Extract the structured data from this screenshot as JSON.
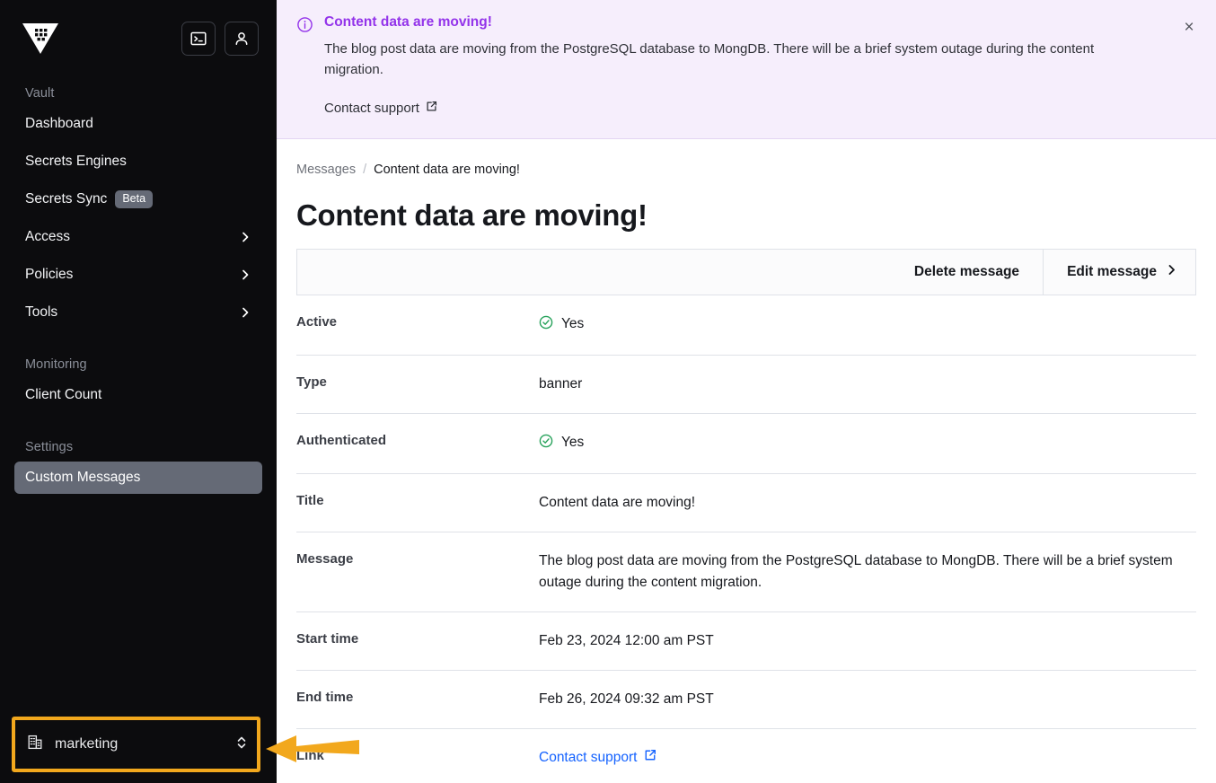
{
  "sidebar": {
    "logo_icon": "vault-logo",
    "actions": [
      {
        "name": "console-toggle-button",
        "icon": "console-icon"
      },
      {
        "name": "user-menu-button",
        "icon": "user-icon"
      }
    ],
    "sections": [
      {
        "label": "Vault",
        "items": [
          {
            "label": "Dashboard",
            "has_chevron": false,
            "active": false
          },
          {
            "label": "Secrets Engines",
            "has_chevron": false,
            "active": false
          },
          {
            "label": "Secrets Sync",
            "badge": "Beta",
            "has_chevron": false,
            "active": false
          },
          {
            "label": "Access",
            "has_chevron": true,
            "active": false
          },
          {
            "label": "Policies",
            "has_chevron": true,
            "active": false
          },
          {
            "label": "Tools",
            "has_chevron": true,
            "active": false
          }
        ]
      },
      {
        "label": "Monitoring",
        "items": [
          {
            "label": "Client Count",
            "has_chevron": false,
            "active": false
          }
        ]
      },
      {
        "label": "Settings",
        "items": [
          {
            "label": "Custom Messages",
            "has_chevron": false,
            "active": true
          }
        ]
      }
    ],
    "namespace_picker": {
      "icon": "building-icon",
      "label": "marketing",
      "selector_icon": "chevron-up-down-icon"
    }
  },
  "annotation": {
    "highlight_color": "#F2A81D",
    "arrow_color": "#F2A81D",
    "target": "namespace-picker"
  },
  "banner": {
    "icon": "info-circle-icon",
    "title": "Content data are moving!",
    "text": "The blog post data are moving from the PostgreSQL database to MongDB. There will be a brief system outage during the content migration.",
    "link_label": "Contact support",
    "link_icon": "external-link-icon",
    "close_label": "×",
    "background_color": "#f6eefc",
    "title_color": "#9333ea"
  },
  "breadcrumb": {
    "parent": "Messages",
    "separator": "/",
    "current": "Content data are moving!"
  },
  "page": {
    "title": "Content data are moving!"
  },
  "toolbar": {
    "delete_label": "Delete message",
    "edit_label": "Edit message",
    "edit_chevron_icon": "chevron-right-icon"
  },
  "details": [
    {
      "label": "Active",
      "value": "Yes",
      "icon": "check-circle-icon",
      "type": "status"
    },
    {
      "label": "Type",
      "value": "banner",
      "type": "text"
    },
    {
      "label": "Authenticated",
      "value": "Yes",
      "icon": "check-circle-icon",
      "type": "status"
    },
    {
      "label": "Title",
      "value": "Content data are moving!",
      "type": "text"
    },
    {
      "label": "Message",
      "value": "The blog post data are moving from the PostgreSQL database to MongDB. There will be a brief system outage during the content migration.",
      "type": "multiline"
    },
    {
      "label": "Start time",
      "value": "Feb 23, 2024 12:00 am PST",
      "type": "text"
    },
    {
      "label": "End time",
      "value": "Feb 26, 2024 09:32 am PST",
      "type": "text"
    },
    {
      "label": "Link",
      "value": "Contact support",
      "icon": "external-link-icon",
      "type": "link"
    }
  ]
}
